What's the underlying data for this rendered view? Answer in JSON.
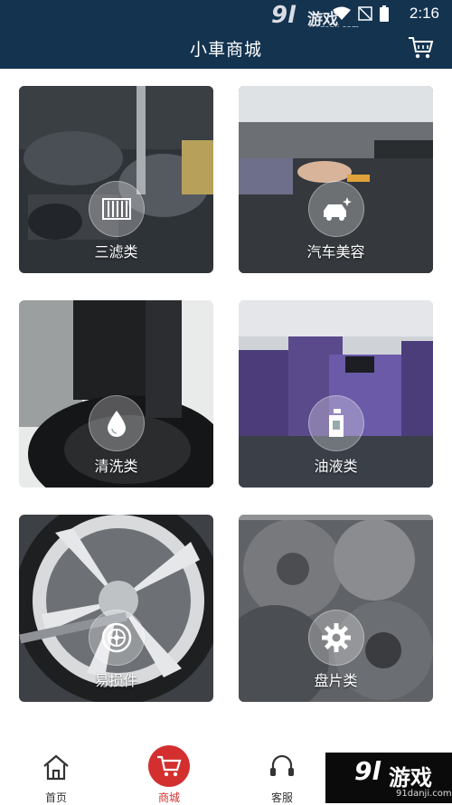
{
  "status": {
    "time": "2:16"
  },
  "watermark_top": {
    "brand": "9l",
    "name": "游戏",
    "url": "91danji.com"
  },
  "header": {
    "title": "小車商城"
  },
  "categories": [
    {
      "label": "三滤类",
      "icon": "filter-icon"
    },
    {
      "label": "汽车美容",
      "icon": "car-wash-icon"
    },
    {
      "label": "清洗类",
      "icon": "droplet-icon"
    },
    {
      "label": "油液类",
      "icon": "oil-bottle-icon"
    },
    {
      "label": "易损件",
      "icon": "wheel-icon"
    },
    {
      "label": "盘片类",
      "icon": "gear-icon"
    }
  ],
  "tabs": [
    {
      "label": "首页",
      "icon": "home-icon",
      "active": false
    },
    {
      "label": "商城",
      "icon": "cart-icon",
      "active": true
    },
    {
      "label": "客服",
      "icon": "headset-icon",
      "active": false
    }
  ],
  "watermark_bottom": {
    "brand": "9l",
    "name": "游戏",
    "url": "91danji.com"
  },
  "colors": {
    "header": "#13334f",
    "accent": "#d32f2f"
  }
}
